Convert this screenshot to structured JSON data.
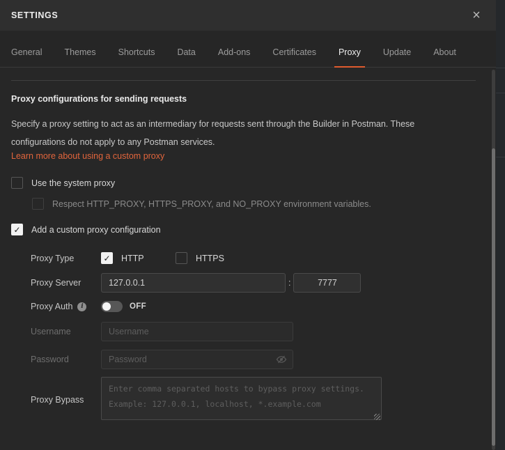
{
  "header": {
    "title": "SETTINGS",
    "close_glyph": "×"
  },
  "tabs": {
    "items": [
      "General",
      "Themes",
      "Shortcuts",
      "Data",
      "Add-ons",
      "Certificates",
      "Proxy",
      "Update",
      "About"
    ],
    "active": "Proxy"
  },
  "section": {
    "heading": "Proxy configurations for sending requests",
    "description": "Specify a proxy setting to act as an intermediary for requests sent through the Builder in Postman. These configurations do not apply to any Postman services.",
    "link": "Learn more about using a custom proxy"
  },
  "checkboxes": {
    "system_proxy": {
      "label": "Use the system proxy",
      "checked": false
    },
    "respect_env": {
      "label": "Respect HTTP_PROXY, HTTPS_PROXY, and NO_PROXY environment variables.",
      "checked": false,
      "disabled": true
    },
    "custom_proxy": {
      "label": "Add a custom proxy configuration",
      "checked": true
    },
    "check_glyph": "✓"
  },
  "form": {
    "proxy_type": {
      "label": "Proxy Type",
      "http": {
        "label": "HTTP",
        "checked": true
      },
      "https": {
        "label": "HTTPS",
        "checked": false
      }
    },
    "proxy_server": {
      "label": "Proxy Server",
      "host_value": "127.0.0.1",
      "separator": ":",
      "port_value": "7777"
    },
    "proxy_auth": {
      "label": "Proxy Auth",
      "info_glyph": "i",
      "state": "OFF",
      "enabled": false
    },
    "username": {
      "label": "Username",
      "placeholder": "Username",
      "value": "",
      "disabled": true
    },
    "password": {
      "label": "Password",
      "placeholder": "Password",
      "value": "",
      "disabled": true
    },
    "proxy_bypass": {
      "label": "Proxy Bypass",
      "placeholder": "Enter comma separated hosts to bypass proxy settings.\nExample: 127.0.0.1, localhost, *.example.com"
    }
  },
  "colors": {
    "accent": "#e05b2e",
    "link": "#e2653c",
    "check_on_bg": "#f2f2f2"
  }
}
